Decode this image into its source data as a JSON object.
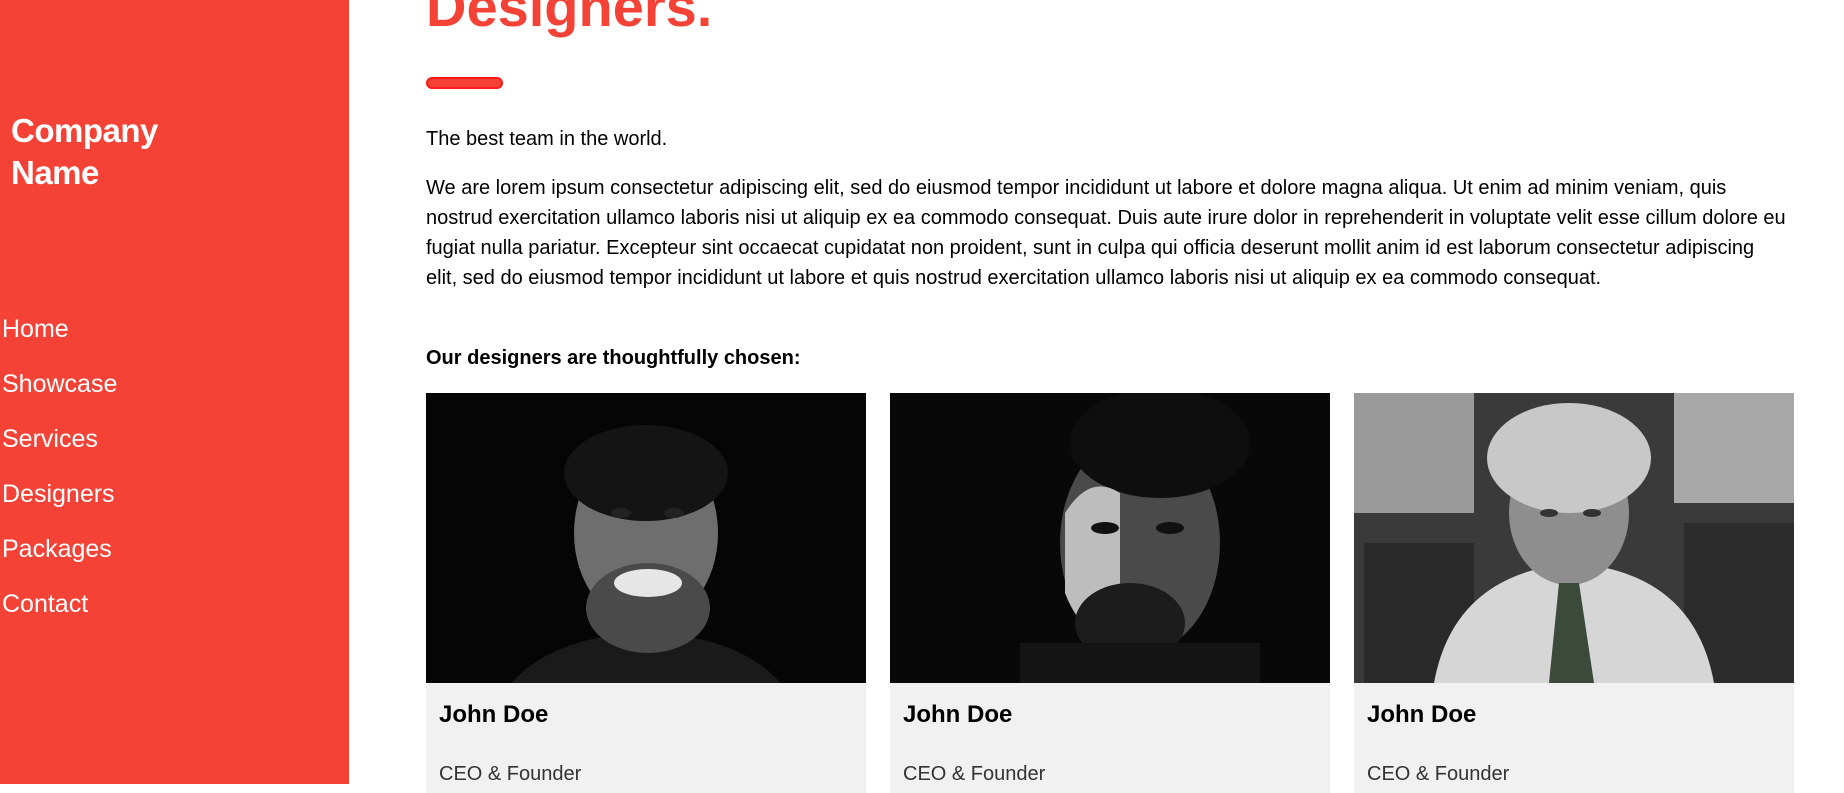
{
  "sidebar": {
    "brand_line1": "Company",
    "brand_line2": "Name",
    "items": [
      {
        "label": "Home"
      },
      {
        "label": "Showcase"
      },
      {
        "label": "Services"
      },
      {
        "label": "Designers"
      },
      {
        "label": "Packages"
      },
      {
        "label": "Contact"
      }
    ],
    "color": "#f44336"
  },
  "main": {
    "title": "Designers.",
    "tagline": "The best team in the world.",
    "description": "We are lorem ipsum consectetur adipiscing elit, sed do eiusmod tempor incididunt ut labore et dolore magna aliqua. Ut enim ad minim veniam, quis nostrud exercitation ullamco laboris nisi ut aliquip ex ea commodo consequat. Duis aute irure dolor in reprehenderit in voluptate velit esse cillum dolore eu fugiat nulla pariatur. Excepteur sint occaecat cupidatat non proident, sunt in culpa qui officia deserunt mollit anim id est laborum consectetur adipiscing elit, sed do eiusmod tempor incididunt ut labore et quis nostrud exercitation ullamco laboris nisi ut aliquip ex ea commodo consequat.",
    "subheading": "Our designers are thoughtfully chosen:",
    "accent_color": "#f44336",
    "designers": [
      {
        "name": "John Doe",
        "role": "CEO & Founder"
      },
      {
        "name": "John Doe",
        "role": "CEO & Founder"
      },
      {
        "name": "John Doe",
        "role": "CEO & Founder"
      }
    ]
  }
}
